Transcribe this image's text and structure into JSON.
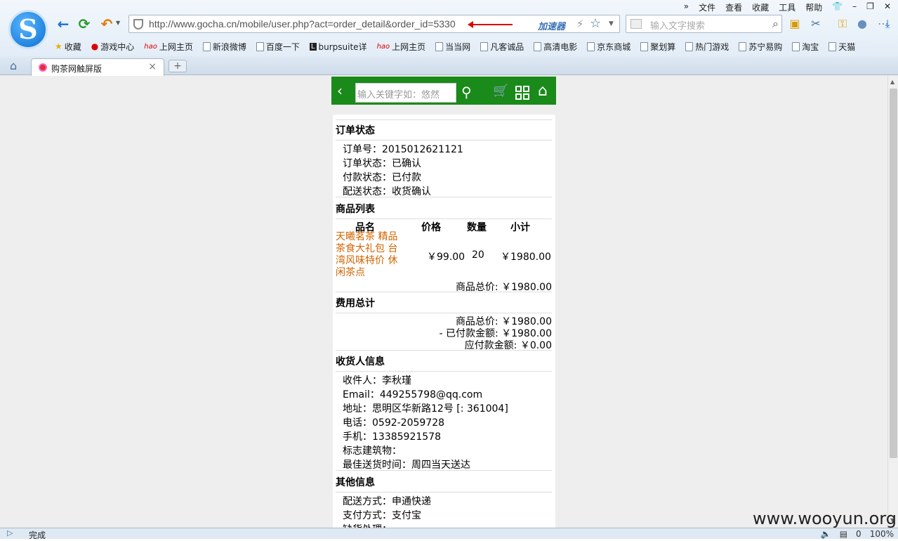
{
  "menu": [
    "文件",
    "查看",
    "收藏",
    "工具",
    "帮助"
  ],
  "address": {
    "url": "http://www.gocha.cn/mobile/user.php?act=order_detail&order_id=5330",
    "accelerator": "加速器"
  },
  "search": {
    "placeholder": "输入文字搜索"
  },
  "bookmarks": [
    "收藏",
    "游戏中心",
    "上网主页",
    "新浪微博",
    "百度一下",
    "burpsuite详",
    "上网主页",
    "当当网",
    "凡客诚品",
    "高清电影",
    "京东商城",
    "聚划算",
    "热门游戏",
    "苏宁易购",
    "淘宝",
    "天猫"
  ],
  "tab": {
    "title": "购茶网触屏版"
  },
  "status": {
    "text": "完成",
    "right": [
      "0",
      "100%"
    ]
  },
  "watermark": "www.wooyun.org",
  "mobile_header": {
    "search_placeholder": "输入关键字如：悠然"
  },
  "order": {
    "status_title": "订单状态",
    "order_no": "订单号：2015012621121",
    "order_status": "订单状态：已确认",
    "pay_status": "付款状态：已付款",
    "ship_status": "配送状态：收货确认",
    "goods_title": "商品列表",
    "col_name": "品名",
    "col_price": "价格",
    "col_qty": "数量",
    "col_subtotal": "小计",
    "product_name": "天曦茗茶 精品茶食大礼包 台湾风味特价 休闲茶点",
    "product_price": "￥99.00",
    "product_qty": "20",
    "product_subtotal": "￥1980.00",
    "goods_total": "商品总价: ￥1980.00",
    "fee_title": "费用总计",
    "fee_goods_total": "商品总价: ￥1980.00",
    "fee_paid": "- 已付款金额: ￥1980.00",
    "fee_due": "应付款金额: ￥0.00",
    "consignee_title": "收货人信息",
    "consignee": "收件人：李秋瑾",
    "email": "Email：449255798@qq.com",
    "address": "地址：思明区华新路12号 [: 361004]",
    "phone": "电话：0592-2059728",
    "mobile": "手机：13385921578",
    "landmark": "标志建筑物：",
    "best_time": "最佳送货时间：周四当天送达",
    "other_title": "其他信息",
    "shipping": "配送方式：申通快递",
    "payment": "支付方式：支付宝",
    "stockout": "缺货处理："
  }
}
